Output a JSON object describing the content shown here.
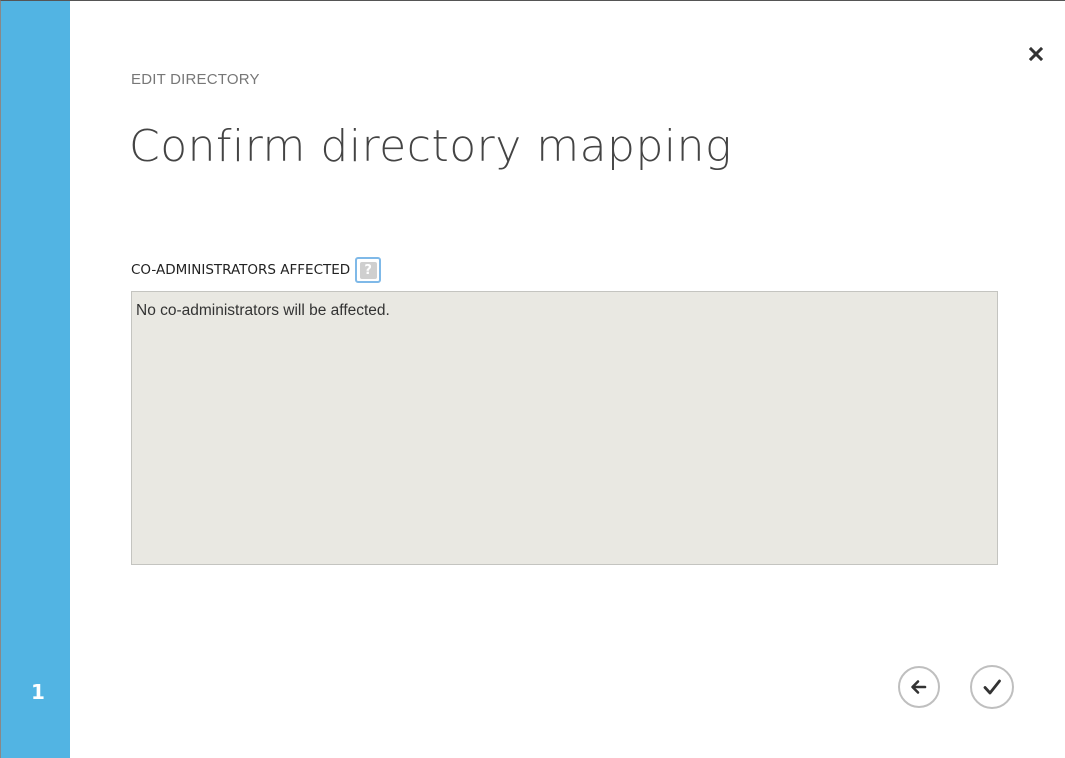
{
  "step": {
    "number": "1",
    "rail_color": "#52b4e3"
  },
  "header": {
    "subtitle": "EDIT DIRECTORY",
    "title": "Confirm directory mapping"
  },
  "field": {
    "label": "CO-ADMINISTRATORS AFFECTED",
    "help_glyph": "?",
    "value": "No co-administrators will be affected."
  },
  "icons": {
    "close": "close-icon",
    "help": "help-icon",
    "back": "back-arrow-icon",
    "confirm": "checkmark-icon"
  },
  "colors": {
    "accent": "#52b4e3",
    "box_background": "#e9e8e2",
    "help_border": "#7fb9e8"
  }
}
